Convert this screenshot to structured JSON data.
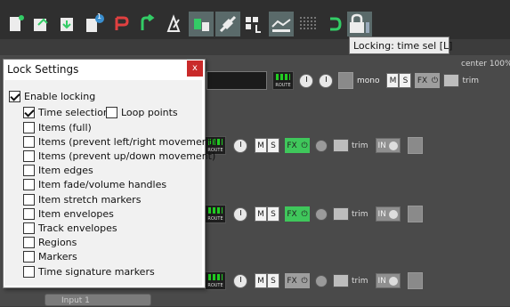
{
  "toolbar": {
    "buttons": [
      {
        "name": "new-project-icon"
      },
      {
        "name": "open-project-icon"
      },
      {
        "name": "save-project-icon"
      },
      {
        "name": "project-tabs-icon",
        "badge": "1"
      },
      {
        "name": "undo-icon"
      },
      {
        "name": "redo-icon"
      },
      {
        "name": "metronome-icon"
      },
      {
        "name": "auto-crossfade-icon"
      },
      {
        "name": "ripple-edit-icon"
      },
      {
        "name": "grid-snap-icon"
      },
      {
        "name": "envelope-points-icon"
      },
      {
        "name": "snap-grid-lines-icon"
      },
      {
        "name": "loop-icon"
      },
      {
        "name": "lock-icon"
      }
    ],
    "tooltip": "Locking: time sel [L]"
  },
  "tracks": {
    "master": {
      "mono_label": "mono",
      "m_label": "M",
      "s_label": "S",
      "fx_label": "FX",
      "trim_label": "trim",
      "route_label": "ROUTE"
    },
    "rows": [
      {
        "route_label": "ROUTE",
        "m_label": "M",
        "s_label": "S",
        "fx_label": "FX",
        "fx_state": "active",
        "trim_label": "trim",
        "input_label": "IN"
      },
      {
        "route_label": "ROUTE",
        "m_label": "M",
        "s_label": "S",
        "fx_label": "FX",
        "fx_state": "active",
        "trim_label": "trim",
        "input_label": "IN"
      },
      {
        "route_label": "ROUTE",
        "m_label": "M",
        "s_label": "S",
        "fx_label": "FX",
        "fx_state": "inactive",
        "trim_label": "trim",
        "input_label": "IN"
      }
    ],
    "center_label": "center 100%",
    "input_chip": "Input 1"
  },
  "dialog": {
    "title": "Lock Settings",
    "close_label": "x",
    "enable": {
      "label": "Enable locking",
      "checked": true
    },
    "time_selection": {
      "label": "Time selection",
      "checked": true
    },
    "loop_points": {
      "label": "Loop points",
      "checked": false
    },
    "items": [
      {
        "label": "Items (full)",
        "checked": false
      },
      {
        "label": "Items (prevent left/right movement)",
        "checked": false
      },
      {
        "label": "Items (prevent up/down movement)",
        "checked": false
      },
      {
        "label": "Item edges",
        "checked": false
      },
      {
        "label": "Item fade/volume handles",
        "checked": false
      },
      {
        "label": "Item stretch markers",
        "checked": false
      },
      {
        "label": "Item envelopes",
        "checked": false
      },
      {
        "label": "Track envelopes",
        "checked": false
      },
      {
        "label": "Regions",
        "checked": false
      },
      {
        "label": "Markers",
        "checked": false
      },
      {
        "label": "Time signature markers",
        "checked": false
      }
    ]
  },
  "colors": {
    "fx_active": "#3fc75b",
    "close_button": "#c92a2a"
  }
}
